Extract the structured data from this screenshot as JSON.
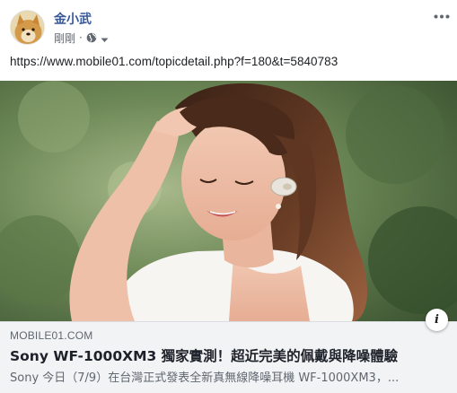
{
  "post": {
    "author_name": "金小武",
    "timestamp": "剛剛",
    "separator": "·",
    "privacy_icon": "globe-icon",
    "more_icon": "ellipsis-icon",
    "text": "https://www.mobile01.com/topicdetail.php?f=180&t=5840783"
  },
  "link_preview": {
    "domain": "MOBILE01.COM",
    "title": "Sony WF-1000XM3 獨家實測！超近完美的佩戴與降噪體驗",
    "description": "Sony 今日（7/9）在台灣正式發表全新真無線降噪耳機 WF-1000XM3，...",
    "info_icon_label": "i"
  },
  "colors": {
    "author": "#385898",
    "secondary_text": "#606770",
    "footer_bg": "#f2f3f5"
  }
}
